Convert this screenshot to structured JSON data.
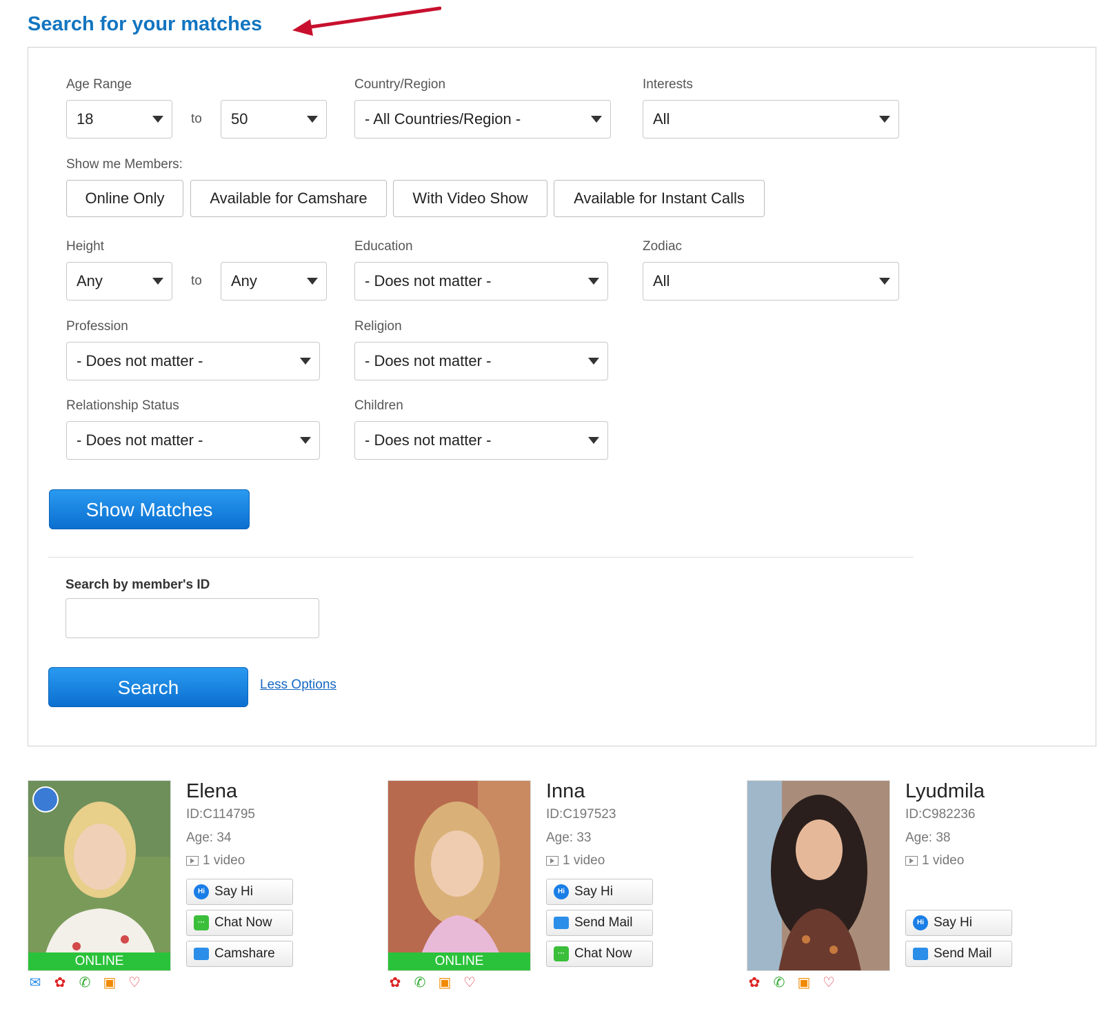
{
  "page": {
    "title": "Search for your matches"
  },
  "form": {
    "age_range_label": "Age Range",
    "age_from": "18",
    "to_label": "to",
    "age_to": "50",
    "country_label": "Country/Region",
    "country_value": "- All Countries/Region -",
    "interests_label": "Interests",
    "interests_value": "All",
    "show_members_label": "Show me Members:",
    "toggles": [
      "Online Only",
      "Available for Camshare",
      "With Video Show",
      "Available for Instant Calls"
    ],
    "height_label": "Height",
    "height_from": "Any",
    "height_to": "Any",
    "education_label": "Education",
    "education_value": "- Does not matter -",
    "zodiac_label": "Zodiac",
    "zodiac_value": "All",
    "profession_label": "Profession",
    "profession_value": "- Does not matter -",
    "religion_label": "Religion",
    "religion_value": "- Does not matter -",
    "relationship_label": "Relationship Status",
    "relationship_value": "- Does not matter -",
    "children_label": "Children",
    "children_value": "- Does not matter -",
    "show_matches_label": "Show Matches",
    "search_id_label": "Search by member's ID",
    "search_id_value": "",
    "search_label": "Search",
    "less_options_label": "Less Options"
  },
  "members": [
    {
      "name": "Elena",
      "id": "ID:C114795",
      "age": "Age: 34",
      "video": "1 video",
      "status": "ONLINE",
      "buttons": [
        "Say Hi",
        "Chat Now",
        "Camshare"
      ]
    },
    {
      "name": "Inna",
      "id": "ID:C197523",
      "age": "Age: 33",
      "video": "1 video",
      "status": "ONLINE",
      "buttons": [
        "Say Hi",
        "Send Mail",
        "Chat Now"
      ]
    },
    {
      "name": "Lyudmila",
      "id": "ID:C982236",
      "age": "Age: 38",
      "video": "1 video",
      "buttons": [
        "Say Hi",
        "Send Mail"
      ]
    }
  ],
  "icons": {
    "mail": "mail-icon",
    "rose": "rose-icon",
    "phone": "phone-icon",
    "gift": "gift-icon",
    "heart": "heart-plus-icon",
    "webcam": "webcam-icon",
    "video": "video-icon",
    "arrow": "red-arrow-annotation"
  },
  "colors": {
    "title": "#1275c0",
    "button_blue": "#1a86e0",
    "online_green": "#2ac23a",
    "arrow_red": "#c8102e",
    "link": "#1567c2"
  }
}
